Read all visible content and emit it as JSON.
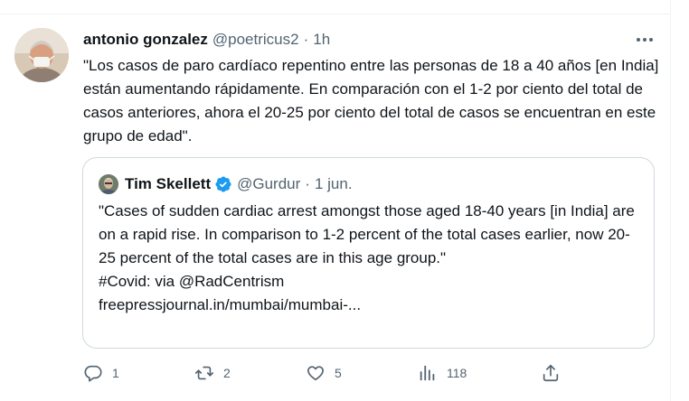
{
  "tweet": {
    "author_name": "antonio gonzalez",
    "author_handle": "@poetricus2",
    "separator": "·",
    "time": "1h",
    "text": "\"Los casos de paro cardíaco repentino entre las personas de 18 a 40 años [en India] están aumentando rápidamente. En comparación con el 1-2 por ciento del total de casos anteriores, ahora el 20-25 por ciento del total de casos se encuentran en este grupo de edad\".",
    "more_icon": "more-horizontal-icon"
  },
  "quote": {
    "author_name": "Tim Skellett",
    "author_handle": "@Gurdur",
    "separator": "·",
    "time": "1 jun.",
    "verified_icon": "verified-badge-icon",
    "verified_color": "#1d9bf0",
    "text": "\"Cases of sudden cardiac arrest amongst those aged 18-40 years [in India] are on a rapid rise. In comparison to 1-2 percent of the total cases earlier,  now 20-25 percent of the total cases are in this age group.\"\n#Covid: via @RadCentrism\nfreepressjournal.in/mumbai/mumbai-..."
  },
  "actions": {
    "reply": {
      "icon": "reply-icon",
      "count": "1"
    },
    "retweet": {
      "icon": "retweet-icon",
      "count": "2"
    },
    "like": {
      "icon": "heart-icon",
      "count": "5"
    },
    "views": {
      "icon": "views-icon",
      "count": "118"
    },
    "share": {
      "icon": "share-icon"
    }
  },
  "colors": {
    "text_primary": "#0f1419",
    "text_secondary": "#536471",
    "border": "#cfd9de"
  }
}
